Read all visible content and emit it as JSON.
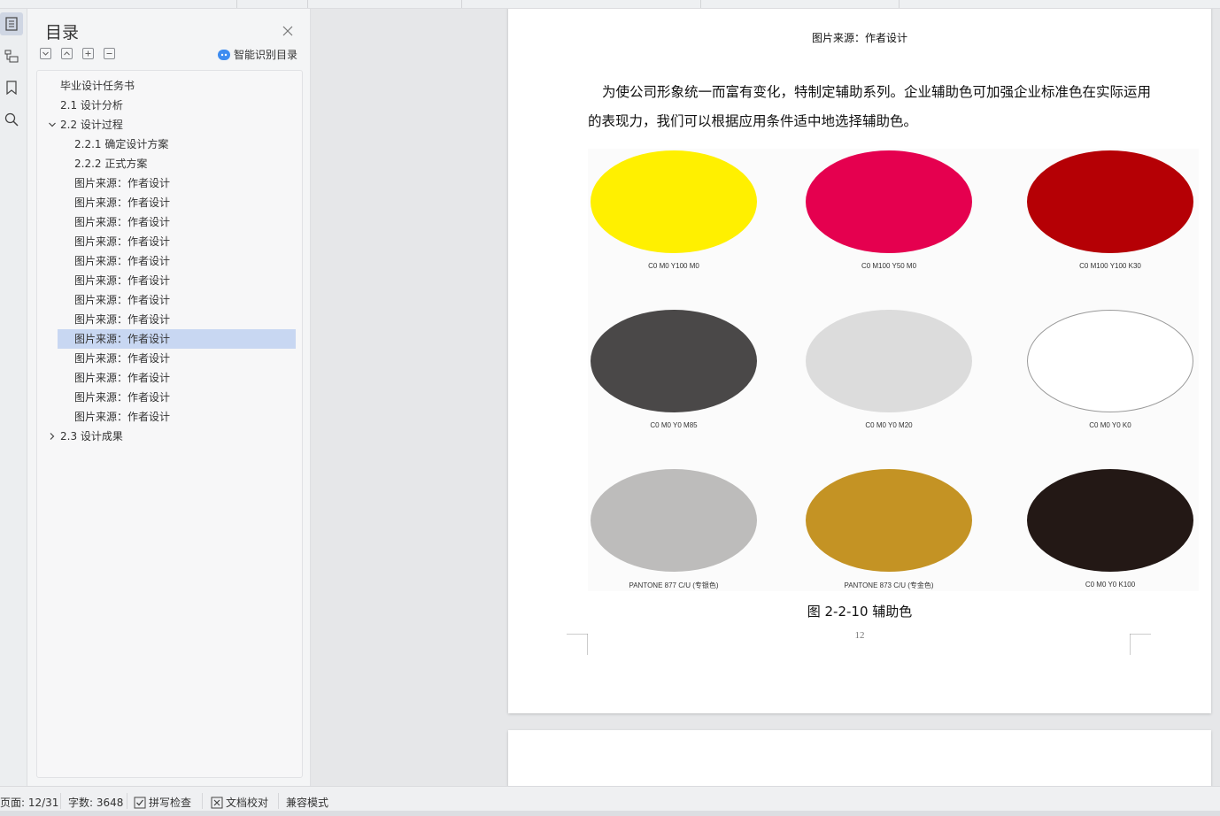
{
  "sidebar": {
    "title": "目录",
    "smart_label": "智能识别目录",
    "icons": [
      "toc-icon",
      "navigation-icon",
      "bookmark-icon",
      "search-icon"
    ],
    "items": [
      {
        "label": "毕业设计任务书",
        "level": 1,
        "expand": "none"
      },
      {
        "label": "2.1 设计分析",
        "level": 1,
        "expand": "none"
      },
      {
        "label": "2.2 设计过程",
        "level": 1,
        "expand": "expanded"
      },
      {
        "label": "2.2.1  确定设计方案",
        "level": 2,
        "expand": "none"
      },
      {
        "label": "2.2.2 正式方案",
        "level": 2,
        "expand": "none"
      },
      {
        "label": "图片来源：作者设计",
        "level": 2,
        "expand": "none"
      },
      {
        "label": "图片来源：作者设计",
        "level": 2,
        "expand": "none"
      },
      {
        "label": "图片来源：作者设计",
        "level": 2,
        "expand": "none"
      },
      {
        "label": "图片来源：作者设计",
        "level": 2,
        "expand": "none"
      },
      {
        "label": "图片来源：作者设计",
        "level": 2,
        "expand": "none"
      },
      {
        "label": "图片来源：作者设计",
        "level": 2,
        "expand": "none"
      },
      {
        "label": "图片来源：作者设计",
        "level": 2,
        "expand": "none"
      },
      {
        "label": "图片来源：作者设计",
        "level": 2,
        "expand": "none"
      },
      {
        "label": "图片来源：作者设计",
        "level": 2,
        "expand": "none",
        "selected": true
      },
      {
        "label": "图片来源：作者设计",
        "level": 2,
        "expand": "none"
      },
      {
        "label": "图片来源：作者设计",
        "level": 2,
        "expand": "none"
      },
      {
        "label": "图片来源：作者设计",
        "level": 2,
        "expand": "none"
      },
      {
        "label": "图片来源：作者设计",
        "level": 2,
        "expand": "none"
      },
      {
        "label": "2.3 设计成果",
        "level": 1,
        "expand": "collapsed"
      }
    ]
  },
  "document": {
    "caption_top": "图片来源：作者设计",
    "paragraph": "为使公司形象统一而富有变化，特制定辅助系列。企业辅助色可加强企业标准色在实际运用的表现力，我们可以根据应用条件适中地选择辅助色。",
    "swatches": [
      {
        "label": "C0 M0 Y100 M0",
        "color": "#fff000",
        "outline": false
      },
      {
        "label": "C0 M100 Y50 M0",
        "color": "#e5004f",
        "outline": false
      },
      {
        "label": "C0 M100 Y100 K30",
        "color": "#b50005",
        "outline": false
      },
      {
        "label": "C0 M0 Y0 M85",
        "color": "#4a4848",
        "outline": false
      },
      {
        "label": "C0 M0 Y0 M20",
        "color": "#dcdcdc",
        "outline": false
      },
      {
        "label": "C0 M0 Y0 K0",
        "color": "#ffffff",
        "outline": true
      },
      {
        "label": "PANTONE 877 C/U (专银色)",
        "color": "#bdbcbb",
        "outline": false
      },
      {
        "label": "PANTONE 873 C/U (专金色)",
        "color": "#c49324",
        "outline": false
      },
      {
        "label": "C0 M0 Y0 K100",
        "color": "#231815",
        "outline": false
      }
    ],
    "figure_caption": "图 2-2-10 辅助色",
    "page_number": "12"
  },
  "status_bar": {
    "page": "页面: 12/31",
    "words": "字数: 3648",
    "spell_check": "拼写检查",
    "doc_proof": "文档校对",
    "compat_mode": "兼容模式"
  },
  "colors": {
    "selected_row": "#c8d7f2",
    "accent": "#3d8cf0"
  }
}
